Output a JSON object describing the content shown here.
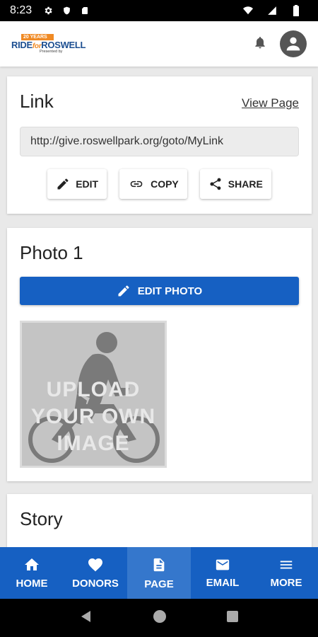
{
  "status_bar": {
    "time": "8:23"
  },
  "header": {
    "logo": {
      "years": "20 YEARS",
      "ride": "RIDE",
      "for": "for",
      "roswell": "ROSWELL",
      "sub": "Presented by"
    }
  },
  "link_card": {
    "title": "Link",
    "view_page": "View Page",
    "url": "http://give.roswellpark.org/goto/MyLink",
    "buttons": {
      "edit": "EDIT",
      "copy": "COPY",
      "share": "SHARE"
    }
  },
  "photo_card": {
    "title": "Photo 1",
    "edit_photo": "EDIT PHOTO",
    "placeholder_lines": [
      "UPLOAD",
      "YOUR OWN",
      "IMAGE"
    ]
  },
  "story_card": {
    "title": "Story"
  },
  "bottom_nav": {
    "items": [
      {
        "label": "HOME",
        "icon": "home-icon"
      },
      {
        "label": "DONORS",
        "icon": "heart-icon"
      },
      {
        "label": "PAGE",
        "icon": "document-icon",
        "active": true
      },
      {
        "label": "EMAIL",
        "icon": "mail-icon"
      },
      {
        "label": "MORE",
        "icon": "menu-icon"
      }
    ]
  },
  "colors": {
    "primary": "#1660c2",
    "active_tab": "#3577cc",
    "accent": "#f08a24"
  }
}
